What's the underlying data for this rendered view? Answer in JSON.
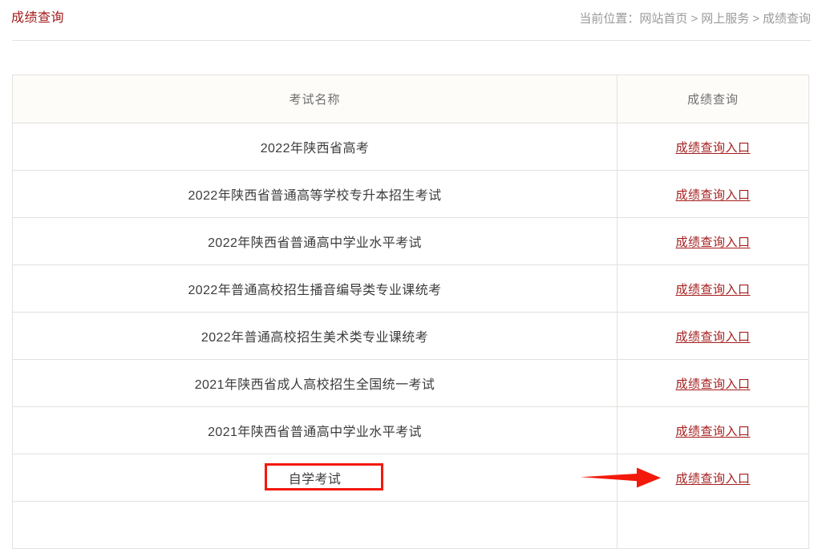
{
  "header": {
    "title": "成绩查询",
    "breadcrumb": {
      "prefix": "当前位置：",
      "items": [
        "网站首页",
        "网上服务",
        "成绩查询"
      ],
      "separator": ">"
    }
  },
  "table": {
    "columns": [
      "考试名称",
      "成绩查询"
    ],
    "link_label": "成绩查询入口",
    "rows": [
      {
        "name": "2022年陕西省高考",
        "link": "成绩查询入口"
      },
      {
        "name": "2022年陕西省普通高等学校专升本招生考试",
        "link": "成绩查询入口"
      },
      {
        "name": "2022年陕西省普通高中学业水平考试",
        "link": "成绩查询入口"
      },
      {
        "name": "2022年普通高校招生播音编导类专业课统考",
        "link": "成绩查询入口"
      },
      {
        "name": "2022年普通高校招生美术类专业课统考",
        "link": "成绩查询入口"
      },
      {
        "name": "2021年陕西省成人高校招生全国统一考试",
        "link": "成绩查询入口"
      },
      {
        "name": "2021年陕西省普通高中学业水平考试",
        "link": "成绩查询入口"
      },
      {
        "name": "自学考试",
        "link": "成绩查询入口"
      },
      {
        "name": "",
        "link": ""
      }
    ]
  },
  "annotations": {
    "highlight_box_target": "自学考试",
    "arrow_target": "成绩查询入口",
    "color": "#f2190a"
  },
  "colors": {
    "title": "#a31919",
    "link": "#a51d1d",
    "breadcrumb": "#9a9a9a",
    "border": "#e3e1dd",
    "header_bg": "#fdfcf9",
    "annotation": "#f2190a"
  }
}
